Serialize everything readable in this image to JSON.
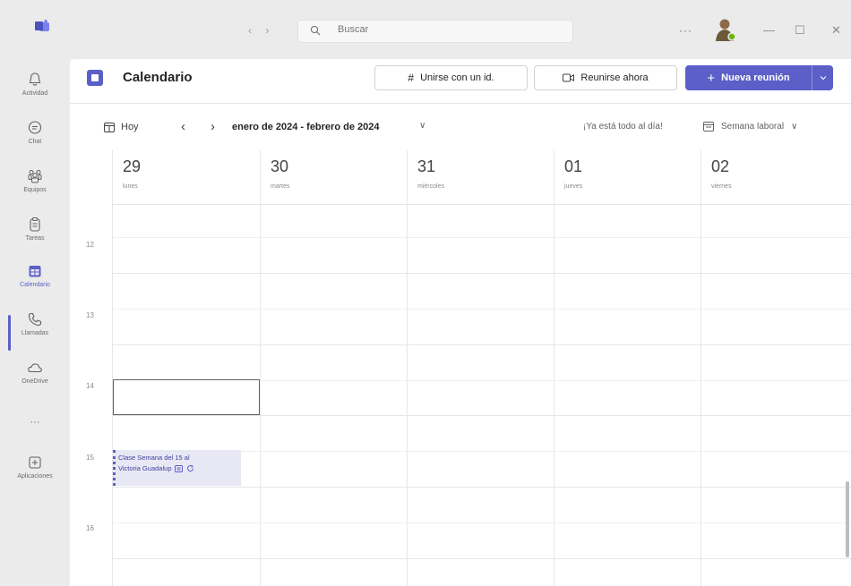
{
  "titlebar": {
    "nav": "‹  ›",
    "search_placeholder": "Buscar",
    "more": "···",
    "minimize": "—",
    "maximize": "☐",
    "close": "✕"
  },
  "rail": {
    "items": [
      {
        "label": "Actividad",
        "icon": "bell-icon"
      },
      {
        "label": "Chat",
        "icon": "chat-icon"
      },
      {
        "label": "Equipos",
        "icon": "teams-icon"
      },
      {
        "label": "Tareas",
        "icon": "tasks-icon"
      },
      {
        "label": "Calendario",
        "icon": "calendar-icon"
      },
      {
        "label": "Llamadas",
        "icon": "phone-icon"
      },
      {
        "label": "OneDrive",
        "icon": "cloud-icon"
      },
      {
        "label": "",
        "icon": "more-icon"
      },
      {
        "label": "Aplicaciones",
        "icon": "apps-icon"
      }
    ],
    "more_dots": "···"
  },
  "header": {
    "title": "Calendario",
    "join_label": "Unirse con un id.",
    "join_icon_glyph": "#",
    "meet_now_label": "Reunirse ahora",
    "new_meeting_label": "Nueva reunión",
    "new_meeting_icon_glyph": "+"
  },
  "toolbar": {
    "today_label": "Hoy",
    "prev": "‹",
    "next": "›",
    "range_label": "enero de 2024 - febrero de 2024",
    "range_chevron": "∨",
    "status_text": "¡Ya está todo al día!",
    "view_label": "Semana laboral",
    "view_chevron": "∨"
  },
  "days": [
    {
      "num": "29",
      "name": "lunes"
    },
    {
      "num": "30",
      "name": "martes"
    },
    {
      "num": "31",
      "name": "miércoles"
    },
    {
      "num": "01",
      "name": "jueves"
    },
    {
      "num": "02",
      "name": "viernes"
    }
  ],
  "hours": [
    "12",
    "13",
    "14",
    "15",
    "16"
  ],
  "event": {
    "title": "Clase Semana del 15 al",
    "organizer": "Victoria Guadalup"
  },
  "colors": {
    "accent": "#5b5fc7",
    "rail_bg": "#ebebeb",
    "event_bg": "#e8e8f5"
  }
}
